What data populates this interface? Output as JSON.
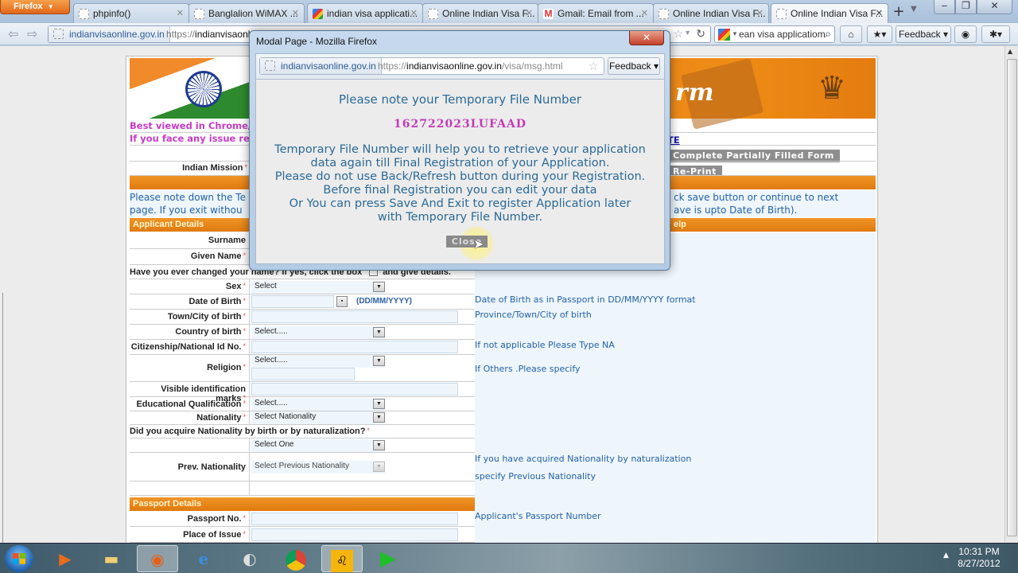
{
  "browser": {
    "menu_button": "Firefox",
    "tabs": [
      {
        "label": "phpinfo()",
        "icon": "page-icon",
        "active": false
      },
      {
        "label": "Banglalion WiMAX ...",
        "icon": "page-icon",
        "active": false
      },
      {
        "label": "indian visa applicati...",
        "icon": "google-icon",
        "active": false
      },
      {
        "label": "Online Indian Visa F...",
        "icon": "page-icon",
        "active": false
      },
      {
        "label": "Gmail: Email from ...",
        "icon": "gmail-icon",
        "active": false
      },
      {
        "label": "Online Indian Visa F...",
        "icon": "page-icon",
        "active": false
      },
      {
        "label": "Online Indian Visa F...",
        "icon": "page-icon",
        "active": true
      }
    ],
    "address": {
      "identity": "indianvisaonline.gov.in",
      "url_prefix": "https://",
      "url_host": "indianvisaonl"
    },
    "search_value": "ean visa applicatiom",
    "feedback_label": "Feedback"
  },
  "page": {
    "best_viewed": "Best viewed in Chrome/I",
    "issue_line": "If you face any issue rel",
    "note_link": "TE",
    "nav_buttons": [
      "Complete Partially Filled Form",
      "Re-Print"
    ],
    "indian_mission_label": "Indian Mission",
    "info_left_1": "Please note down the Te",
    "info_left_2": "page. If you exit withou",
    "info_right_1": "ck save button or continue to next",
    "info_right_2": "ave is upto Date of Birth).",
    "applicant_details_header": "Applicant Details",
    "help_header": "elp",
    "passport_details_header": "Passport Details",
    "banner_title": "rm",
    "fields": {
      "surname": "Surname",
      "given_name": "Given Name",
      "name_changed_question": "Have you ever changed your name? If yes, click the box",
      "name_changed_suffix": "and give details.",
      "sex": "Sex",
      "sex_value": "Select",
      "dob": "Date of Birth",
      "dob_format": "(DD/MM/YYYY)",
      "town": "Town/City of birth",
      "country": "Country of birth",
      "country_value": "Select.....",
      "citizenship": "Citizenship/National Id No.",
      "religion": "Religion",
      "religion_value": "Select.....",
      "visible_marks": "Visible identification marks",
      "education": "Educational Qualification",
      "education_value": "Select.....",
      "nationality": "Nationality",
      "nationality_value": "Select Nationality",
      "acquire_question": "Did you acquire Nationality by birth or by naturalization?",
      "acquire_value": "Select One",
      "prev_nationality": "Prev. Nationality",
      "prev_nationality_value": "Select Previous Nationality",
      "passport_no": "Passport No.",
      "place_of_issue": "Place of Issue"
    },
    "help": {
      "dob": "Date of Birth as in Passport in DD/MM/YYYY format",
      "town": "Province/Town/City of birth",
      "citizenship": "If not applicable Please Type NA",
      "religion": "If Others .Please specify",
      "prev_nat_1": "If you have acquired Nationality by naturalization",
      "prev_nat_2": "specify Previous Nationality",
      "passport_no": "Applicant's Passport Number"
    }
  },
  "modal": {
    "window_title": "Modal Page - Mozilla Firefox",
    "identity": "indianvisaonline.gov.in",
    "url_prefix": "https://",
    "url_host": "indianvisaonline.gov.in",
    "url_path": "/visa/msg.html",
    "feedback_label": "Feedback",
    "heading": "Please note your Temporary File Number",
    "file_number": "162722023LUFAAD",
    "message_lines": [
      "Temporary File Number will help you to retrieve your application",
      "data again till Final Registration of your Application.",
      "Please do not use Back/Refresh button during your Registration.",
      "Before final Registration you can edit your data",
      "Or You can press Save And Exit to register Application later",
      "with Temporary File Number."
    ],
    "close_label": "Close"
  },
  "taskbar": {
    "apps": [
      "windows-media-player",
      "file-explorer",
      "firefox",
      "internet-explorer",
      "media-app",
      "chrome",
      "banglalion",
      "idm"
    ],
    "time": "10:31 PM",
    "date": "8/27/2012"
  },
  "colors": {
    "accent_orange": "#e9850f",
    "file_number": "#c23cb8",
    "info_text": "#2361a8"
  }
}
